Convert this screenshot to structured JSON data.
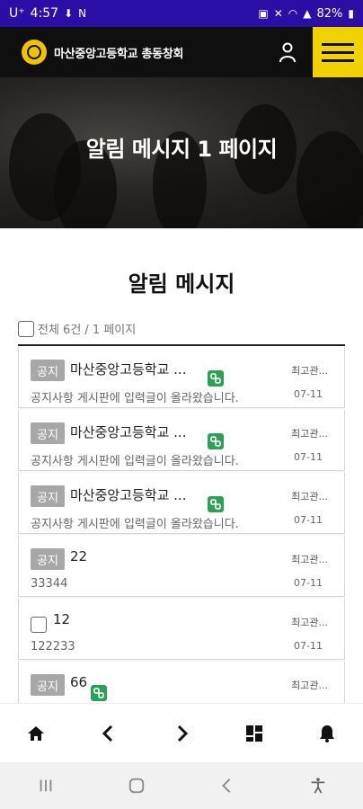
{
  "status_bar": {
    "carrier": "U⁺",
    "time": "4:57",
    "battery": "82%"
  },
  "header": {
    "school_name": "마산중앙고등학교 총동창회",
    "accent_color": "#f2d100"
  },
  "hero": {
    "title": "알림 메시지 1 페이지"
  },
  "section": {
    "title": "알림 메시지",
    "count_text": "전체 6건 / 1 페이지"
  },
  "items": [
    {
      "badge": "공지",
      "title": "마산중앙고등학교 ...",
      "subtitle": "공지사항 게시판에 입력글이 올라왔습니다.",
      "author": "최고관...",
      "date": "07-11",
      "has_link": true,
      "has_checkbox": false
    },
    {
      "badge": "공지",
      "title": "마산중앙고등학교 ...",
      "subtitle": "공지사항 게시판에 입력글이 올라왔습니다.",
      "author": "최고관...",
      "date": "07-11",
      "has_link": true,
      "has_checkbox": false
    },
    {
      "badge": "공지",
      "title": "마산중앙고등학교 ...",
      "subtitle": "공지사항 게시판에 입력글이 올라왔습니다.",
      "author": "최고관...",
      "date": "07-11",
      "has_link": true,
      "has_checkbox": false
    },
    {
      "badge": "공지",
      "title": "22",
      "subtitle": "33344",
      "author": "최고관...",
      "date": "07-11",
      "has_link": false,
      "has_checkbox": false
    },
    {
      "badge": "",
      "title": "12",
      "subtitle": "122233",
      "author": "최고관...",
      "date": "07-11",
      "has_link": false,
      "has_checkbox": true
    },
    {
      "badge": "공지",
      "title": "66",
      "subtitle": "",
      "author": "최고관...",
      "date": "",
      "has_link": true,
      "has_checkbox": false
    }
  ],
  "bottom_nav": {
    "icons": [
      "home-icon",
      "chevron-left-icon",
      "chevron-right-icon",
      "dashboard-icon",
      "bell-icon"
    ]
  },
  "system_nav": {
    "icons": [
      "recents-icon",
      "home-circle-icon",
      "back-icon",
      "accessibility-icon"
    ]
  }
}
